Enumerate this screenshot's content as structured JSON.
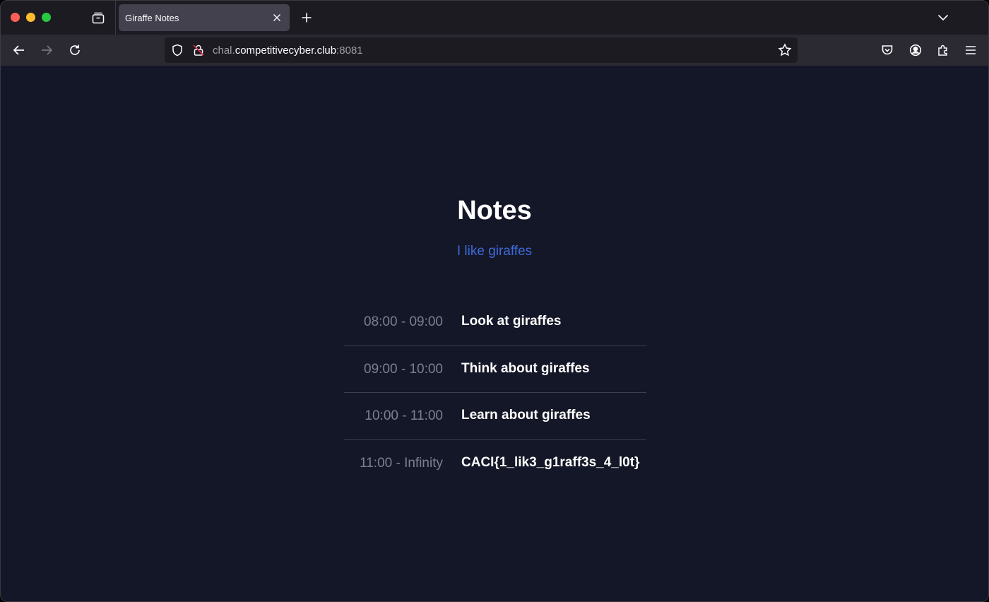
{
  "browser": {
    "tab_title": "Giraffe Notes",
    "url": {
      "subdomain": "chal.",
      "domain": "competitivecyber.club",
      "port": ":8081"
    }
  },
  "page": {
    "title": "Notes",
    "subtitle": "I like giraffes",
    "schedule": [
      {
        "time": "08:00 - 09:00",
        "task": "Look at giraffes"
      },
      {
        "time": "09:00 - 10:00",
        "task": "Think about giraffes"
      },
      {
        "time": "10:00 - 11:00",
        "task": "Learn about giraffes"
      },
      {
        "time": "11:00 - Infinity",
        "task": "CACI{1_lik3_g1raff3s_4_l0t}"
      }
    ]
  },
  "colors": {
    "page_background": "#141727",
    "accent_link": "#3f6ad8",
    "muted_time": "#7b8090"
  },
  "icons": [
    "tabs-view-icon",
    "close-icon",
    "plus-icon",
    "chevron-down-icon",
    "back-arrow-icon",
    "forward-arrow-icon",
    "reload-icon",
    "shield-icon",
    "insecure-lock-icon",
    "star-icon",
    "pocket-icon",
    "account-icon",
    "extensions-icon",
    "menu-icon"
  ]
}
